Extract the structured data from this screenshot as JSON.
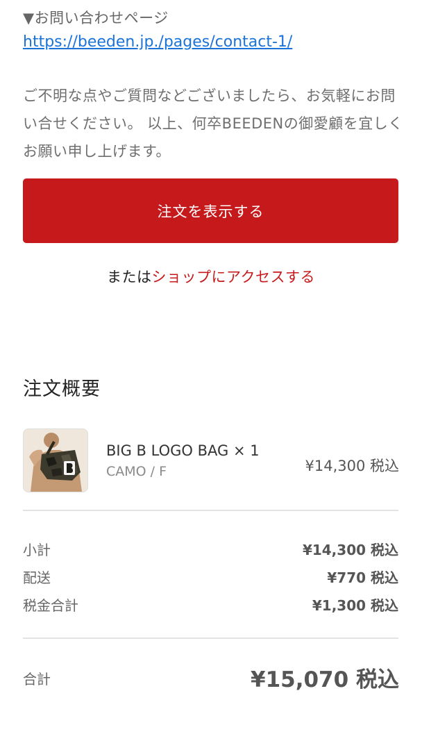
{
  "contact": {
    "heading": "▼お問い合わせページ",
    "link": "https://beeden.jp./pages/contact-1/"
  },
  "message": {
    "closing": "ご不明な点やご質問などございましたら、お気軽にお問い合せください。 以上、何卒BEEDENの御愛顧を宜しくお願い申し上げます。"
  },
  "actions": {
    "view_order": "注文を表示する",
    "or_prefix": "または",
    "visit_shop": "ショップにアクセスする"
  },
  "summary": {
    "title": "注文概要",
    "item": {
      "name": "BIG B LOGO BAG × 1",
      "variant": "CAMO / F",
      "price": "¥14,300 税込",
      "image_alt": "product-photo"
    },
    "subtotal": {
      "label": "小計",
      "value": "¥14,300 税込"
    },
    "shipping": {
      "label": "配送",
      "value": "¥770 税込"
    },
    "tax": {
      "label": "税金合計",
      "value": "¥1,300 税込"
    },
    "total": {
      "label": "合計",
      "value": "¥15,070 税込"
    }
  },
  "colors": {
    "accent": "#c6191b",
    "link": "#1a73d9"
  }
}
